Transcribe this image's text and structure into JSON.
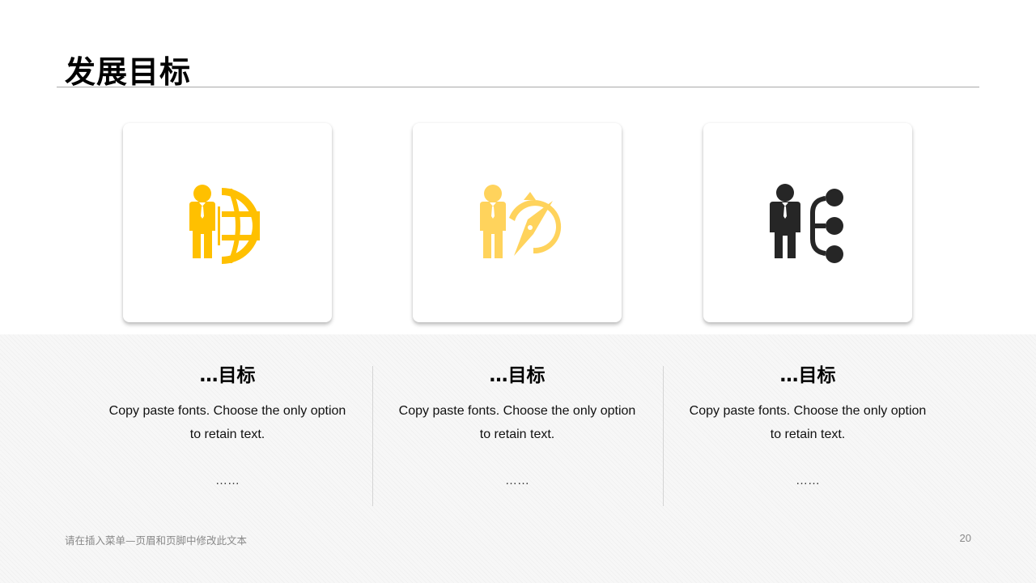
{
  "title": "发展目标",
  "columns": [
    {
      "icon": "businessman-globe-icon",
      "icon_color": "#FFC000",
      "heading": "…目标",
      "text": "Copy paste fonts. Choose the only option to retain text.",
      "dots": "……"
    },
    {
      "icon": "businessman-compass-icon",
      "icon_color": "#FFD35C",
      "heading": "…目标",
      "text": "Copy paste fonts. Choose the only option to retain text.",
      "dots": "……"
    },
    {
      "icon": "businessman-network-icon",
      "icon_color": "#262626",
      "heading": "…目标",
      "text": "Copy paste fonts. Choose the only option to retain text.",
      "dots": "……"
    }
  ],
  "footer": {
    "text": "请在插入菜单—页眉和页脚中修改此文本",
    "page_number": "20"
  }
}
